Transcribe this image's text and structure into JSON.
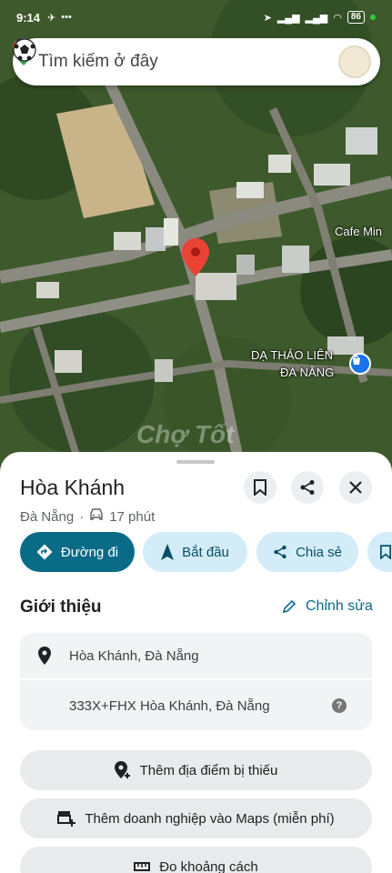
{
  "status_bar": {
    "time": "9:14",
    "battery": "86"
  },
  "search": {
    "placeholder": "Tìm kiếm ở đây"
  },
  "map": {
    "labels": {
      "cafe": "Cafe Min",
      "poi_line1": "DẠ THẢO LIÊN",
      "poi_line2": "ĐÀ NẴNG"
    },
    "watermark": "Chợ Tốt"
  },
  "place": {
    "name": "Hòa Khánh",
    "city": "Đà Nẵng",
    "drive_time": "17 phút"
  },
  "chips": {
    "directions": "Đường đi",
    "start": "Bắt đầu",
    "share": "Chia sẻ"
  },
  "about": {
    "title": "Giới thiệu",
    "edit": "Chỉnh sửa",
    "address": "Hòa Khánh, Đà Nẵng",
    "plus_code": "333X+FHX Hòa Khánh, Đà Nẵng"
  },
  "actions": {
    "add_missing": "Thêm địa điểm bị thiếu",
    "add_business": "Thêm doanh nghiệp vào Maps (miễn phí)",
    "measure": "Đo khoảng cách"
  },
  "colors": {
    "primary": "#0a6b87",
    "chip": "#d3ecf7",
    "pin": "#ea4335"
  }
}
